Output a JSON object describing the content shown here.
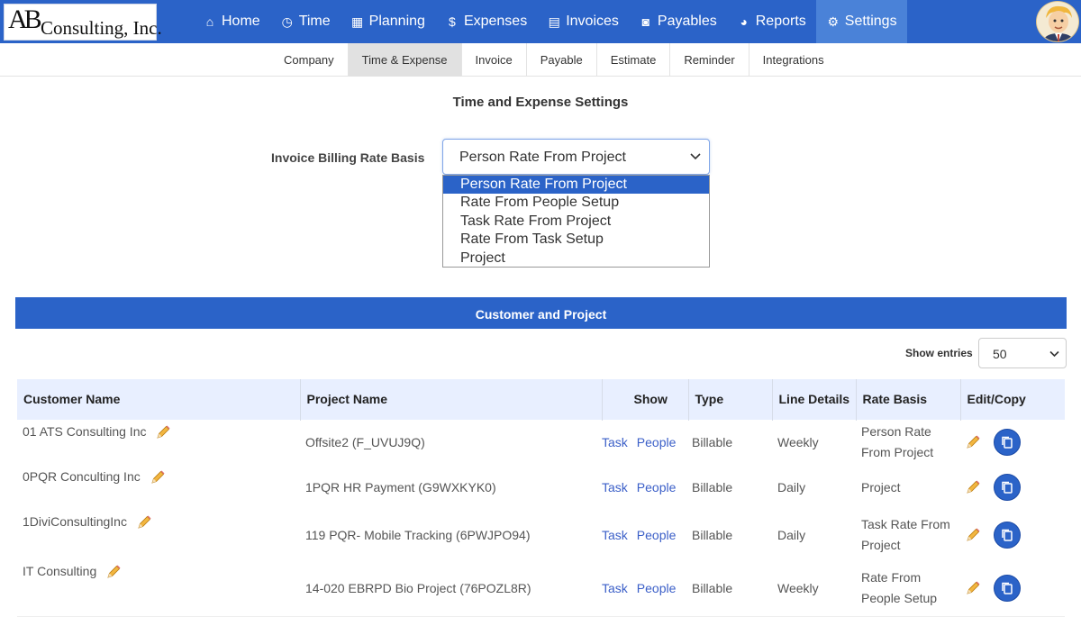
{
  "logo": {
    "letters": "AB",
    "text": "Consulting, Inc."
  },
  "nav": {
    "items": [
      {
        "label": "Home",
        "icon": "home-icon",
        "glyph": "⌂"
      },
      {
        "label": "Time",
        "icon": "clock-icon",
        "glyph": "◷"
      },
      {
        "label": "Planning",
        "icon": "calendar-icon",
        "glyph": "▦"
      },
      {
        "label": "Expenses",
        "icon": "dollar-icon",
        "glyph": "$"
      },
      {
        "label": "Invoices",
        "icon": "document-icon",
        "glyph": "▤"
      },
      {
        "label": "Payables",
        "icon": "money-icon",
        "glyph": "◙"
      },
      {
        "label": "Reports",
        "icon": "pie-chart-icon",
        "glyph": "◕"
      },
      {
        "label": "Settings",
        "icon": "gears-icon",
        "glyph": "⚙"
      }
    ]
  },
  "subnav": {
    "items": [
      "Company",
      "Time & Expense",
      "Invoice",
      "Payable",
      "Estimate",
      "Reminder",
      "Integrations"
    ]
  },
  "settings": {
    "title": "Time and Expense Settings",
    "rate_label": "Invoice Billing Rate Basis",
    "rate_value": "Person Rate From Project",
    "options": [
      "Person Rate From Project",
      "Rate From People Setup",
      "Task Rate From Project",
      "Rate From Task Setup",
      "Project"
    ]
  },
  "section": {
    "title": "Customer and Project"
  },
  "entries": {
    "label": "Show entries",
    "value": "50"
  },
  "table": {
    "headers": [
      "Customer Name",
      "Project Name",
      "Show",
      "Type",
      "Line Details",
      "Rate Basis",
      "Edit/Copy"
    ],
    "rows": [
      {
        "customer": "01 ATS Consulting Inc",
        "project": "Offsite2 (F_UVUJ9Q)",
        "task": "Task",
        "people": "People",
        "type": "Billable",
        "line": "Weekly",
        "rate": "Person Rate From Project"
      },
      {
        "customer": "0PQR Conculting Inc",
        "project": "1PQR HR Payment (G9WXKYK0)",
        "task": "Task",
        "people": "People",
        "type": "Billable",
        "line": "Daily",
        "rate": "Project"
      },
      {
        "customer": "1DiviConsultingInc",
        "project": "119 PQR- Mobile Tracking (6PWJPO94)",
        "task": "Task",
        "people": "People",
        "type": "Billable",
        "line": "Daily",
        "rate": "Task Rate From Project"
      },
      {
        "customer": "IT Consulting",
        "project": "14-020 EBRPD Bio Project (76POZL8R)",
        "task": "Task",
        "people": "People",
        "type": "Billable",
        "line": "Weekly",
        "rate": "Rate From People Setup"
      }
    ]
  },
  "colors": {
    "brand": "#2b63c8",
    "active_nav": "#4a82d8",
    "table_header": "#e8efff"
  }
}
